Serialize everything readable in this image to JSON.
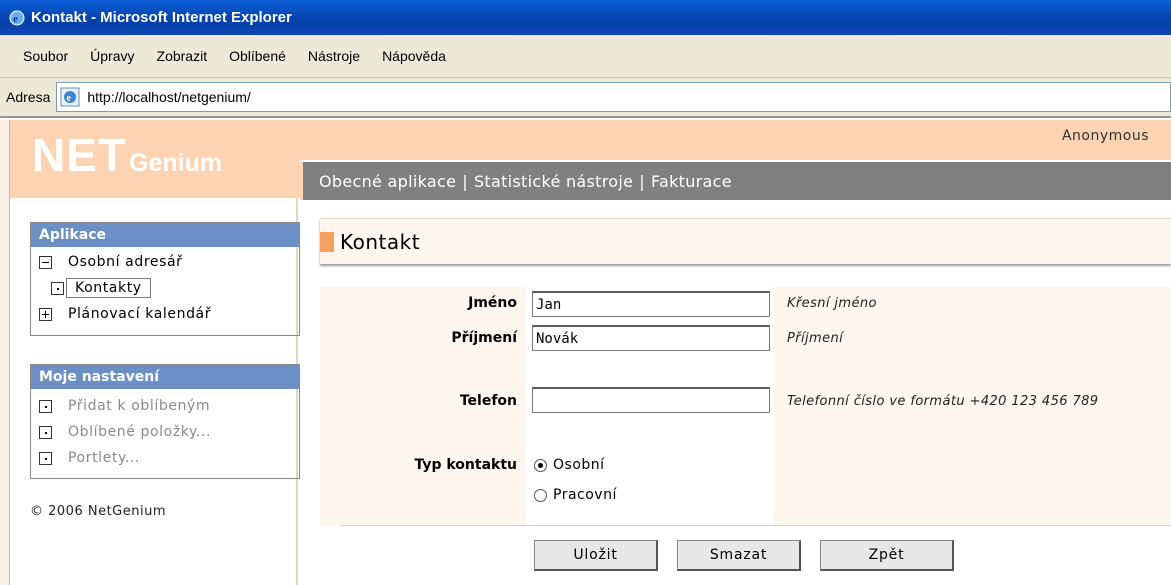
{
  "window": {
    "title": "Kontakt - Microsoft Internet Explorer"
  },
  "menu": [
    "Soubor",
    "Úpravy",
    "Zobrazit",
    "Oblíbené",
    "Nástroje",
    "Nápověda"
  ],
  "address": {
    "label": "Adresa",
    "url": "http://localhost/netgenium/"
  },
  "header": {
    "user": "Anonymous",
    "logo_net": "NET",
    "logo_genium": "Genium"
  },
  "topnav": [
    "Obecné aplikace",
    "Statistické nástroje",
    "Fakturace"
  ],
  "sidebar": {
    "aplikace": {
      "title": "Aplikace",
      "items": [
        "Osobní adresář",
        "Kontakty",
        "Plánovací kalendář"
      ]
    },
    "nastaveni": {
      "title": "Moje nastavení",
      "items": [
        "Přidat k oblíbeným",
        "Oblíbené položky...",
        "Portlety..."
      ]
    },
    "copyright": "© 2006 NetGenium"
  },
  "page": {
    "title": "Kontakt"
  },
  "form": {
    "jmeno": {
      "label": "Jméno",
      "value": "Jan",
      "hint": "Křesní jméno"
    },
    "prijmeni": {
      "label": "Příjmení",
      "value": "Novák",
      "hint": "Příjmení"
    },
    "telefon": {
      "label": "Telefon",
      "value": "",
      "hint": "Telefonní číslo ve formátu +420 123 456 789"
    },
    "typ": {
      "label": "Typ kontaktu",
      "options": [
        "Osobní",
        "Pracovní"
      ],
      "selected": "Osobní"
    }
  },
  "buttons": {
    "save": "Uložit",
    "delete": "Smazat",
    "back": "Zpět"
  }
}
